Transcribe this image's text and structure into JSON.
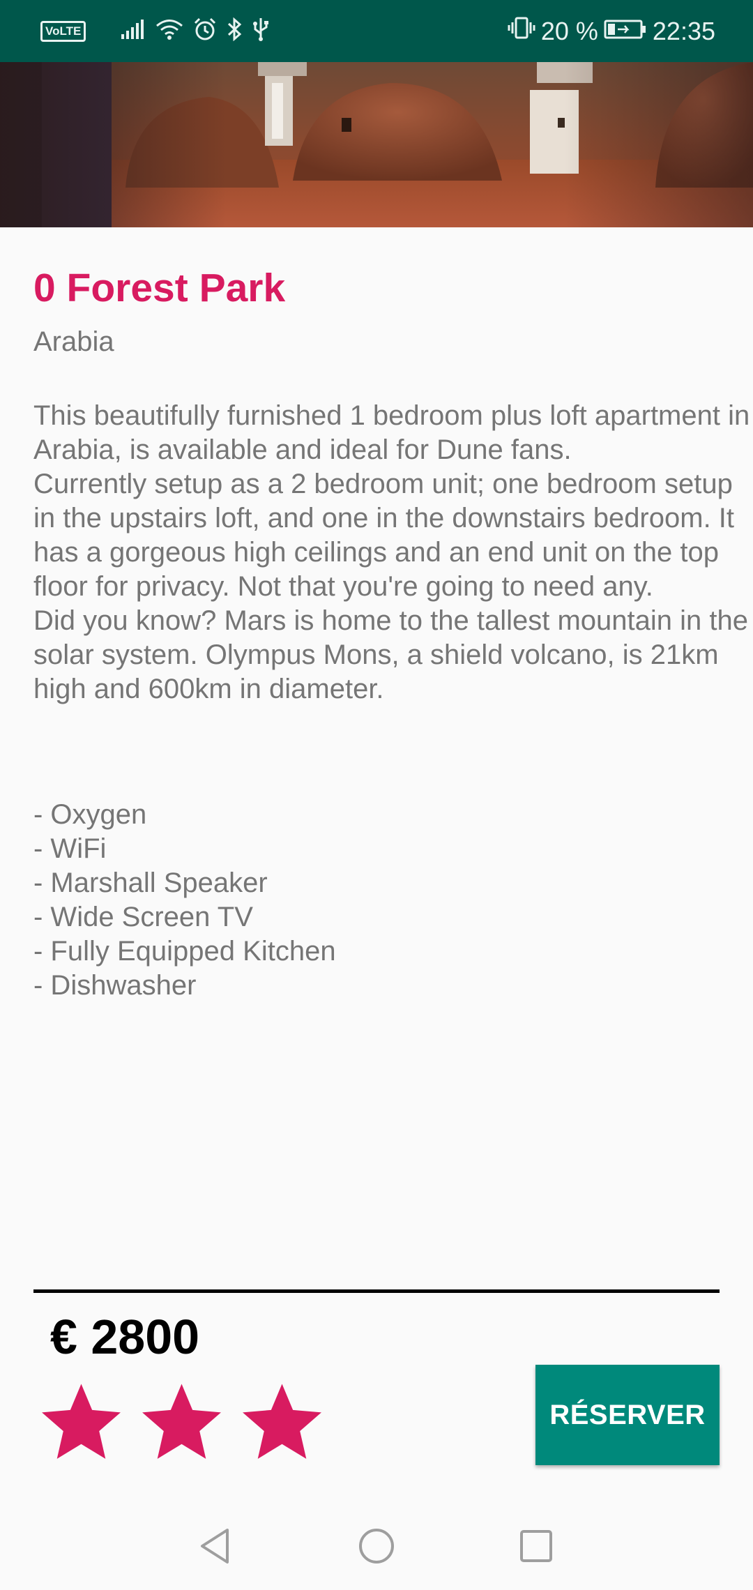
{
  "status_bar": {
    "volte": "VoLTE",
    "battery_percent": "20 %",
    "time": "22:35",
    "background_color": "#00574b",
    "left_icons": [
      "signal-icon",
      "wifi-icon",
      "alarm-icon",
      "bluetooth-icon",
      "usb-icon"
    ],
    "right_icons": [
      "vibrate-icon",
      "battery-charging-icon"
    ]
  },
  "listing": {
    "title": "0 Forest Park",
    "location": "Arabia",
    "description": [
      "This beautifully furnished 1 bedroom plus loft apartment in Arabia, is available and ideal for Dune fans.",
      "Currently setup as a 2 bedroom unit; one bedroom setup in the upstairs loft, and one in the downstairs bedroom. It has a gorgeous high ceilings and an end unit on the top floor for privacy. Not that you're going to need any.",
      "Did you know? Mars is home to the tallest mountain in the solar system. Olympus Mons, a shield volcano, is 21km high and 600km in diameter."
    ],
    "amenities": [
      "- Oxygen",
      "- WiFi",
      "- Marshall Speaker",
      "- Wide Screen TV",
      "- Fully Equipped Kitchen",
      "- Dishwasher"
    ]
  },
  "booking": {
    "price": "€ 2800",
    "rating": 3,
    "star_color": "#d81b60",
    "reserve_label": "RÉSERVER",
    "button_color": "#00897b"
  },
  "colors": {
    "accent": "#d81b60",
    "primary_dark": "#00574b",
    "primary": "#00897b"
  },
  "nav_bar": {
    "icons": [
      "back-icon",
      "home-icon",
      "recents-icon"
    ]
  }
}
